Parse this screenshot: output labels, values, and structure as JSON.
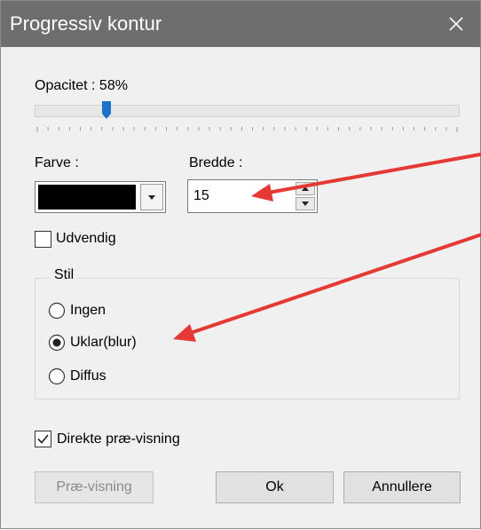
{
  "window": {
    "title": "Progressiv kontur",
    "close_icon": "close-icon"
  },
  "opacity": {
    "label": "Opacitet : 58%",
    "value_percent": 58,
    "thumb_fraction": 0.17
  },
  "color": {
    "label": "Farve :",
    "selected_color": "#000000"
  },
  "width": {
    "label": "Bredde :",
    "value": "15"
  },
  "outside": {
    "label": "Udvendig",
    "checked": false
  },
  "style_group": {
    "legend": "Stil",
    "options": [
      {
        "label": "Ingen",
        "selected": false
      },
      {
        "label": "Uklar(blur)",
        "selected": true
      },
      {
        "label": "Diffus",
        "selected": false
      }
    ]
  },
  "preview_toggle": {
    "label": "Direkte præ-visning",
    "checked": true
  },
  "buttons": {
    "preview": "Præ-visning",
    "ok": "Ok",
    "cancel": "Annullere"
  },
  "annotations": {
    "arrow_color": "#e53935"
  }
}
